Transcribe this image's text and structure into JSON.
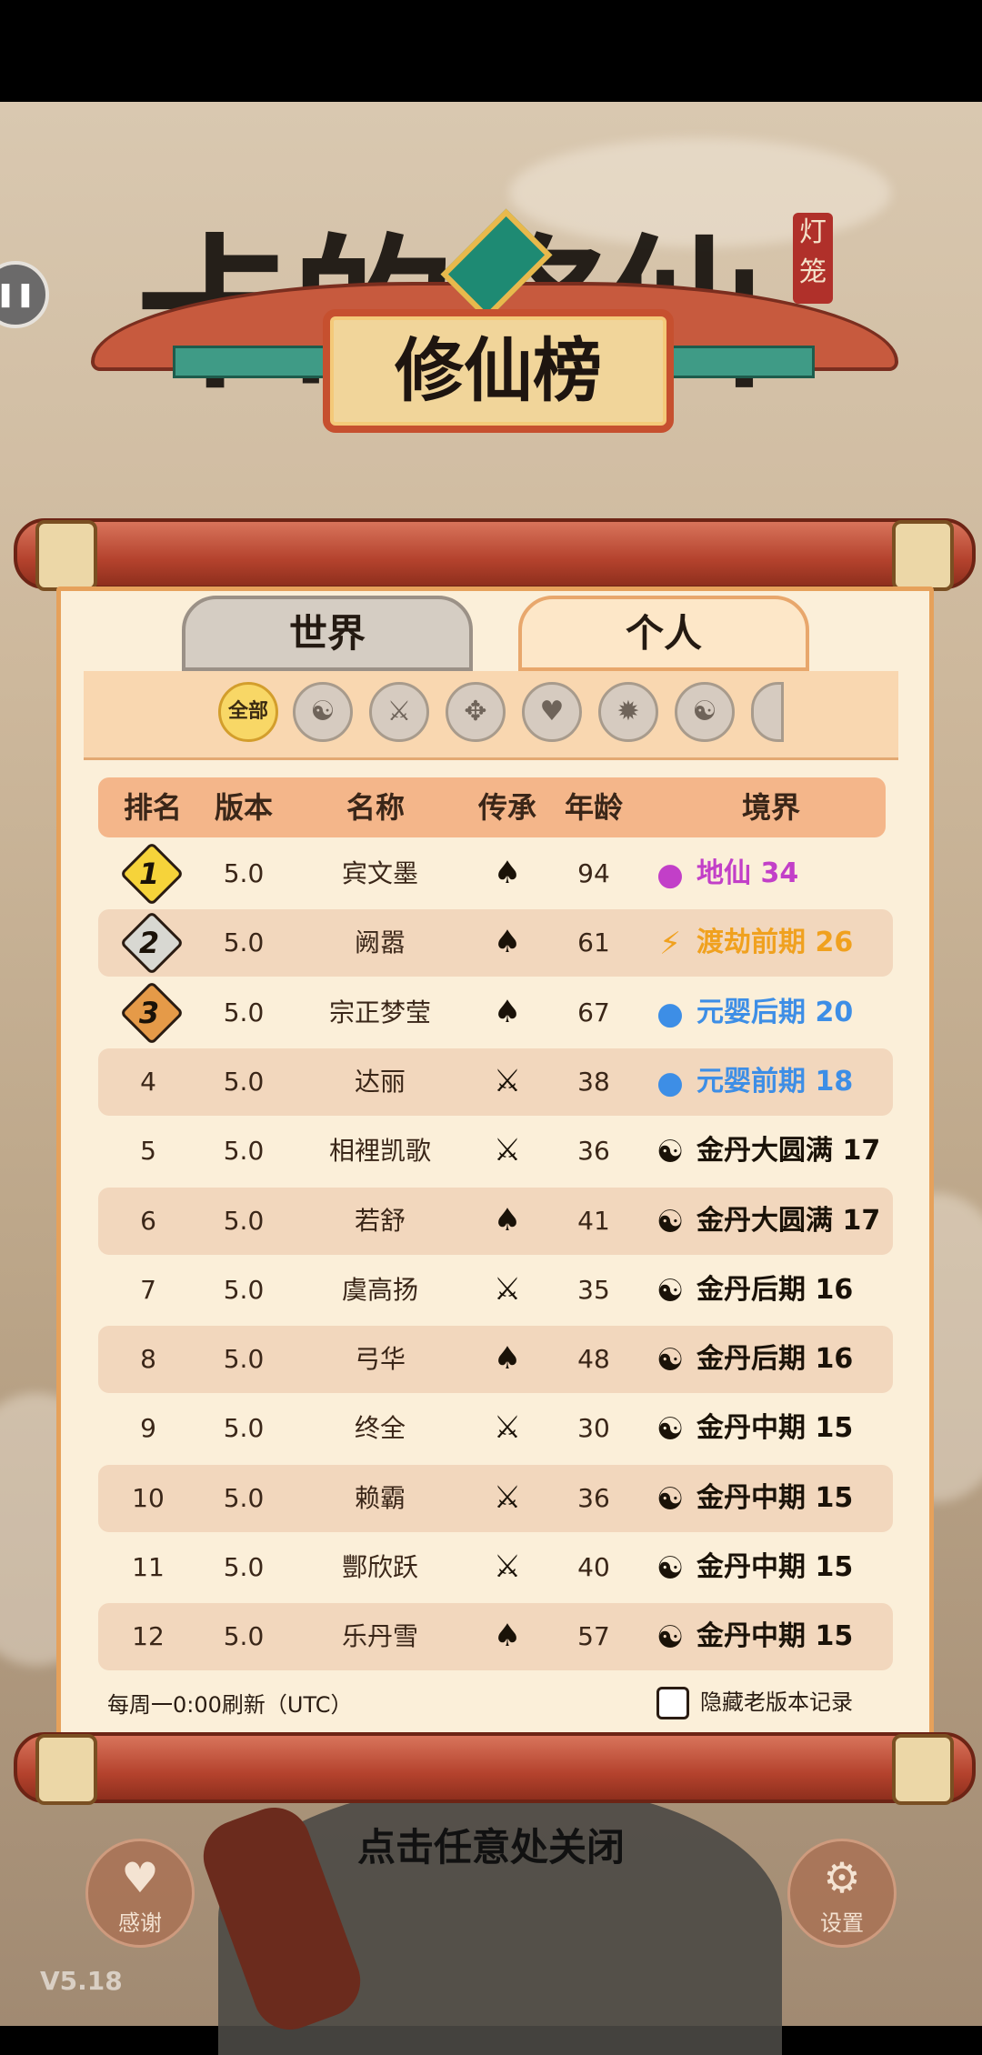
{
  "header": {
    "bg_title": "卡的修仙",
    "seal_text": "灯笼",
    "plaque_title": "修仙榜"
  },
  "tabs": [
    {
      "label": "世界",
      "active": false
    },
    {
      "label": "个人",
      "active": true
    }
  ],
  "filters": {
    "all_label": "全部",
    "icons": [
      "yin-yang-icon",
      "sword-icon",
      "book-icon",
      "heart-icon",
      "flame-icon",
      "swirl-icon",
      "more-icon"
    ]
  },
  "table": {
    "headers": [
      "排名",
      "版本",
      "名称",
      "传承",
      "年龄",
      "境界"
    ],
    "rows": [
      {
        "rank": "1",
        "version": "5.0",
        "name": "宾文墨",
        "lineage": "flame",
        "age": "94",
        "realm": "地仙 34",
        "realm_color": "#c23fc8"
      },
      {
        "rank": "2",
        "version": "5.0",
        "name": "阙嚣",
        "lineage": "flame",
        "age": "61",
        "realm": "渡劫前期 26",
        "realm_color": "#f0a11f"
      },
      {
        "rank": "3",
        "version": "5.0",
        "name": "宗正梦莹",
        "lineage": "flame",
        "age": "67",
        "realm": "元婴后期 20",
        "realm_color": "#3d8ee6"
      },
      {
        "rank": "4",
        "version": "5.0",
        "name": "达丽",
        "lineage": "sword",
        "age": "38",
        "realm": "元婴前期 18",
        "realm_color": "#3d8ee6"
      },
      {
        "rank": "5",
        "version": "5.0",
        "name": "相裡凯歌",
        "lineage": "sword",
        "age": "36",
        "realm": "金丹大圆满 17",
        "realm_color": "#1a1208"
      },
      {
        "rank": "6",
        "version": "5.0",
        "name": "若舒",
        "lineage": "flame",
        "age": "41",
        "realm": "金丹大圆满 17",
        "realm_color": "#1a1208"
      },
      {
        "rank": "7",
        "version": "5.0",
        "name": "虞高扬",
        "lineage": "sword",
        "age": "35",
        "realm": "金丹后期 16",
        "realm_color": "#1a1208"
      },
      {
        "rank": "8",
        "version": "5.0",
        "name": "弓华",
        "lineage": "flame",
        "age": "48",
        "realm": "金丹后期 16",
        "realm_color": "#1a1208"
      },
      {
        "rank": "9",
        "version": "5.0",
        "name": "终全",
        "lineage": "sword",
        "age": "30",
        "realm": "金丹中期 15",
        "realm_color": "#1a1208"
      },
      {
        "rank": "10",
        "version": "5.0",
        "name": "赖霸",
        "lineage": "sword",
        "age": "36",
        "realm": "金丹中期 15",
        "realm_color": "#1a1208"
      },
      {
        "rank": "11",
        "version": "5.0",
        "name": "酆欣跃",
        "lineage": "sword",
        "age": "40",
        "realm": "金丹中期 15",
        "realm_color": "#1a1208"
      },
      {
        "rank": "12",
        "version": "5.0",
        "name": "乐丹雪",
        "lineage": "flame",
        "age": "57",
        "realm": "金丹中期 15",
        "realm_color": "#1a1208"
      }
    ]
  },
  "footer": {
    "refresh_note": "每周一0:00刷新（UTC）",
    "hide_old_label": "隐藏老版本记录",
    "hide_old_checked": false
  },
  "close_hint": "点击任意处关闭",
  "buttons": {
    "thanks_label": "感谢",
    "settings_label": "设置"
  },
  "version": "V5.18",
  "colors": {
    "gold_medal": "#f6d33a",
    "silver_medal": "#d8d8d2",
    "bronze_medal": "#e59a48"
  }
}
